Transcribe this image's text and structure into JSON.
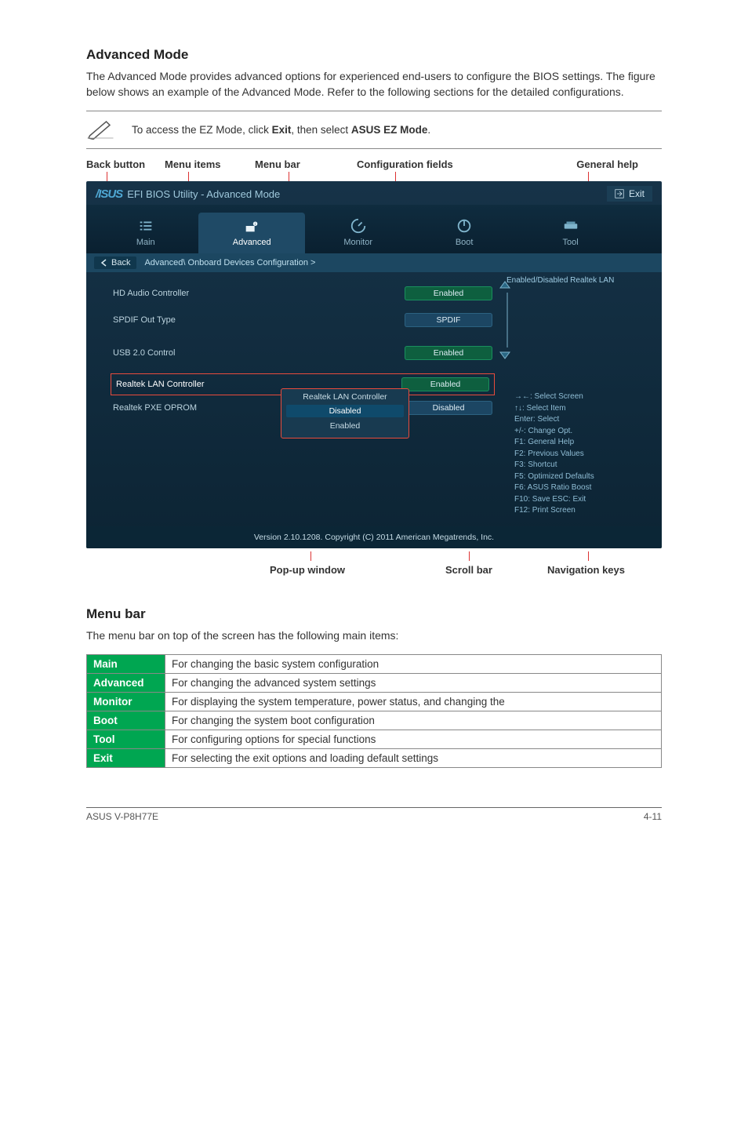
{
  "section1_title": "Advanced Mode",
  "section1_body": "The Advanced Mode provides advanced options for experienced end-users to configure the BIOS settings. The figure below shows an example of the Advanced Mode. Refer to the following sections for the detailed configurations.",
  "note_text_pre": "To access the EZ Mode, click ",
  "note_text_bold1": "Exit",
  "note_text_mid": ", then select ",
  "note_text_bold2": "ASUS EZ Mode",
  "note_text_post": ".",
  "legend": {
    "back": "Back button",
    "items": "Menu items",
    "bar": "Menu bar",
    "conf": "Configuration fields",
    "help": "General help",
    "popup": "Pop-up window",
    "scroll": "Scroll bar",
    "nav": "Navigation keys"
  },
  "bios": {
    "title": "EFI BIOS Utility - Advanced Mode",
    "exit": "Exit",
    "tabs": [
      "Main",
      "Advanced",
      "Monitor",
      "Boot",
      "Tool"
    ],
    "breadcrumb_back": "Back",
    "breadcrumb_path": "Advanced\\ Onboard Devices Configuration  >",
    "rows": [
      {
        "label": "HD Audio Controller",
        "value": "Enabled",
        "style": "green"
      },
      {
        "label": "SPDIF Out Type",
        "value": "SPDIF",
        "style": "blue"
      },
      {
        "label": "USB 2.0 Control",
        "value": "Enabled",
        "style": "green"
      },
      {
        "label": "Realtek LAN Controller",
        "value": "Enabled",
        "style": "green",
        "hl": true
      },
      {
        "label": "Realtek PXE OPROM",
        "value": "Disabled",
        "style": "blue"
      }
    ],
    "popup_title": "Realtek LAN Controller",
    "popup_opts": [
      "Disabled",
      "Enabled"
    ],
    "general_help": "Enabled/Disabled Realtek LAN",
    "nav_keys": [
      "→←: Select Screen",
      "↑↓: Select Item",
      "Enter: Select",
      "+/-: Change Opt.",
      "F1: General Help",
      "F2: Previous Values",
      "F3: Shortcut",
      "F5: Optimized Defaults",
      "F6: ASUS Ratio Boost",
      "F10: Save   ESC: Exit",
      "F12: Print Screen"
    ],
    "version": "Version 2.10.1208.   Copyright (C)  2011 American Megatrends, Inc."
  },
  "section2_title": "Menu bar",
  "section2_body": "The menu bar on top of the screen has the following main items:",
  "menubar_rows": [
    {
      "k": "Main",
      "v": "For changing the basic system configuration"
    },
    {
      "k": "Advanced",
      "v": "For changing the advanced system settings"
    },
    {
      "k": "Monitor",
      "v": "For displaying the system temperature, power status, and changing the"
    },
    {
      "k": "Boot",
      "v": "For changing the system boot configuration"
    },
    {
      "k": "Tool",
      "v": "For configuring options for special functions"
    },
    {
      "k": "Exit",
      "v": "For selecting the exit options and loading default settings"
    }
  ],
  "footer_left": "ASUS V-P8H77E",
  "footer_right": "4-11"
}
